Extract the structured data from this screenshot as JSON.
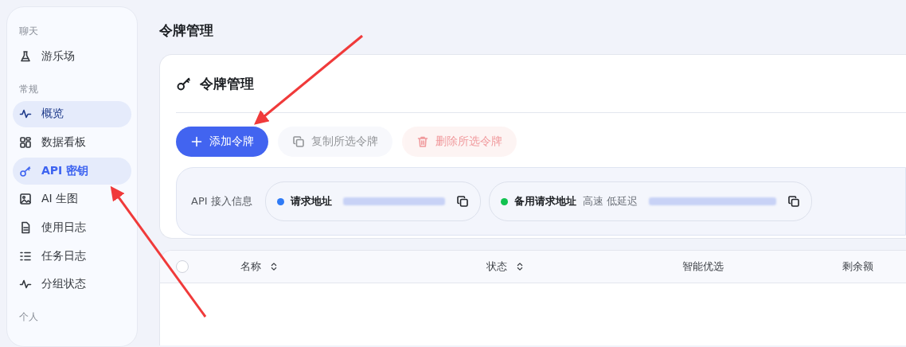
{
  "sidebar": {
    "sections": [
      {
        "title": "聊天",
        "items": [
          {
            "label": "游乐场",
            "selected": false,
            "hovered": false
          }
        ]
      },
      {
        "title": "常规",
        "items": [
          {
            "label": "概览",
            "selected": false,
            "hovered": true
          },
          {
            "label": "数据看板",
            "selected": false,
            "hovered": false
          },
          {
            "label": "API 密钥",
            "selected": true,
            "hovered": false
          },
          {
            "label": "AI 生图",
            "selected": false,
            "hovered": false
          },
          {
            "label": "使用日志",
            "selected": false,
            "hovered": false
          },
          {
            "label": "任务日志",
            "selected": false,
            "hovered": false
          },
          {
            "label": "分组状态",
            "selected": false,
            "hovered": false
          }
        ]
      },
      {
        "title": "个人"
      }
    ]
  },
  "page_title": "令牌管理",
  "card": {
    "title": "令牌管理",
    "buttons": [
      {
        "label": "添加令牌",
        "kind": "primary",
        "disabled": false
      },
      {
        "label": "复制所选令牌",
        "kind": "secondary",
        "disabled": true
      },
      {
        "label": "删除所选令牌",
        "kind": "danger",
        "disabled": true
      }
    ],
    "api_info": {
      "label": "API 接入信息",
      "endpoints": [
        {
          "label": "请求地址",
          "color": "#2f7bf6"
        },
        {
          "label": "备用请求地址",
          "note": "高速 低延迟",
          "color": "#12c250"
        }
      ]
    }
  },
  "table": {
    "select_all": {
      "checked": false
    },
    "columns": [
      {
        "label": "名称",
        "sortable": true
      },
      {
        "label": "状态",
        "sortable": true
      },
      {
        "label": "智能优选",
        "sortable": false
      },
      {
        "label": "剩余额",
        "sortable": false
      }
    ]
  }
}
